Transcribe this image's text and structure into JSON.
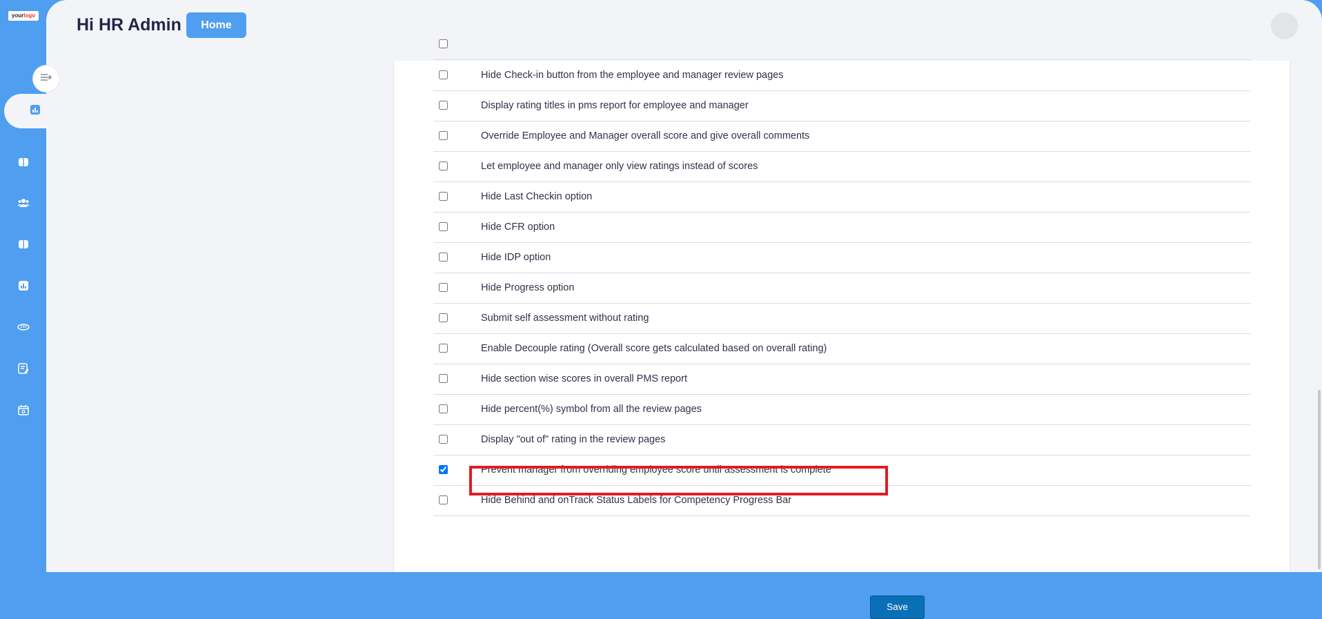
{
  "sidebar": {
    "logo_text_a": "your",
    "logo_text_b": "logo",
    "icons": [
      "collapse-icon",
      "dashboard-icon",
      "book-icon",
      "people-icon",
      "book-icon",
      "report-icon",
      "360-icon",
      "edit-note-icon",
      "calendar-icon"
    ]
  },
  "header": {
    "greeting": "Hi HR Admin",
    "home_label": "Home"
  },
  "settings": {
    "items": [
      {
        "label": "Hide Check-in button from the employee and manager review pages",
        "checked": false
      },
      {
        "label": "Display rating titles in pms report for employee and manager",
        "checked": false
      },
      {
        "label": "Override Employee and Manager overall score and give overall comments",
        "checked": false
      },
      {
        "label": "Let employee and manager only view ratings instead of scores",
        "checked": false
      },
      {
        "label": "Hide Last Checkin option",
        "checked": false
      },
      {
        "label": "Hide CFR option",
        "checked": false
      },
      {
        "label": "Hide IDP option",
        "checked": false
      },
      {
        "label": "Hide Progress option",
        "checked": false
      },
      {
        "label": "Submit self assessment without rating",
        "checked": false
      },
      {
        "label": "Enable Decouple rating (Overall score gets calculated based on overall rating)",
        "checked": false
      },
      {
        "label": "Hide section wise scores in overall PMS report",
        "checked": false
      },
      {
        "label": "Hide percent(%) symbol from all the review pages",
        "checked": false
      },
      {
        "label": "Display \"out of\" rating in the review pages",
        "checked": false
      },
      {
        "label": "Prevent manager from overriding employee score until assessment is complete",
        "checked": true
      },
      {
        "label": "Hide Behind and onTrack Status Labels for Competency Progress Bar",
        "checked": false
      }
    ],
    "save_label": "Save"
  },
  "colors": {
    "accent": "#4f9ef0",
    "save_button": "#0a6fb7",
    "highlight_border": "#e11b22"
  }
}
